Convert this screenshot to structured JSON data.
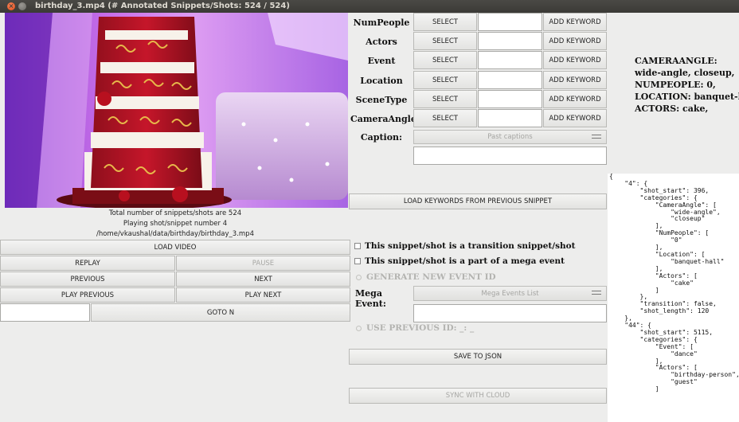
{
  "window": {
    "title": "birthday_3.mp4 (# Annotated Snippets/Shots: 524 / 524)"
  },
  "info": {
    "total": "Total number of snippets/shots are 524",
    "playing": "Playing shot/snippet number 4",
    "path": "/home/vkaushal/data/birthday/birthday_3.mp4"
  },
  "controls": {
    "load_video": "LOAD VIDEO",
    "replay": "REPLAY",
    "pause": "PAUSE",
    "previous": "PREVIOUS",
    "next": "NEXT",
    "play_previous": "PLAY PREVIOUS",
    "play_next": "PLAY NEXT",
    "goto_n": "GOTO N",
    "goto_value": ""
  },
  "categories": [
    {
      "label": "NumPeople",
      "select": "SELECT",
      "add": "ADD KEYWORD",
      "value": ""
    },
    {
      "label": "Actors",
      "select": "SELECT",
      "add": "ADD KEYWORD",
      "value": ""
    },
    {
      "label": "Event",
      "select": "SELECT",
      "add": "ADD KEYWORD",
      "value": ""
    },
    {
      "label": "Location",
      "select": "SELECT",
      "add": "ADD KEYWORD",
      "value": ""
    },
    {
      "label": "SceneType",
      "select": "SELECT",
      "add": "ADD KEYWORD",
      "value": ""
    },
    {
      "label": "CameraAngle",
      "select": "SELECT",
      "add": "ADD KEYWORD",
      "value": ""
    }
  ],
  "caption": {
    "label": "Caption:",
    "dropdown": "Past captions",
    "value": ""
  },
  "load_keywords": "LOAD KEYWORDS FROM PREVIOUS SNIPPET",
  "transition_check": "This snippet/shot is a transition snippet/shot",
  "mega_check": "This snippet/shot is a part of a mega event",
  "generate_radio": "GENERATE NEW EVENT ID",
  "mega_event": {
    "label": "Mega Event:",
    "dropdown": "Mega Events List",
    "value": ""
  },
  "use_previous_radio": "USE PREVIOUS ID: _: _",
  "save_json": "SAVE TO JSON",
  "sync_cloud": "SYNC WITH CLOUD",
  "summary": "CAMERAANGLE:\nwide-angle, closeup,\nNUMPEOPLE: 0,\nLOCATION: banquet-hall,\nACTORS: cake,",
  "json_text": "{\n    \"4\": {\n        \"shot_start\": 396,\n        \"categories\": {\n            \"CameraAngle\": [\n                \"wide-angle\",\n                \"closeup\"\n            ],\n            \"NumPeople\": [\n                \"0\"\n            ],\n            \"Location\": [\n                \"banquet-hall\"\n            ],\n            \"Actors\": [\n                \"cake\"\n            ]\n        },\n        \"transition\": false,\n        \"shot_length\": 120\n    },\n    \"44\": {\n        \"shot_start\": 5115,\n        \"categories\": {\n            \"Event\": [\n                \"dance\"\n            ],\n            \"Actors\": [\n                \"birthday-person\",\n                \"guest\"\n            ]"
}
